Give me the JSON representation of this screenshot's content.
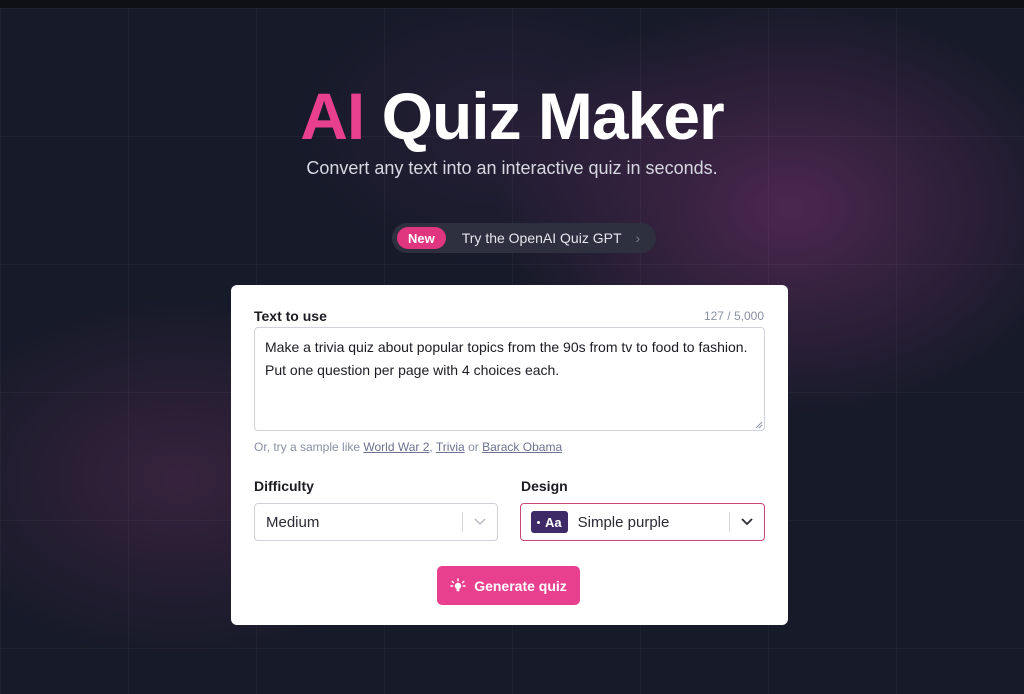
{
  "hero": {
    "title_accent": "AI",
    "title_rest": "Quiz Maker",
    "subtitle": "Convert any text into an interactive quiz in seconds."
  },
  "announcement": {
    "badge": "New",
    "text": "Try the OpenAI Quiz GPT",
    "chevron": "›"
  },
  "form": {
    "text_label": "Text to use",
    "char_count": "127 / 5,000",
    "text_value": "Make a trivia quiz about popular topics from the 90s from tv to food to fashion. Put one question per page with 4 choices each.",
    "samples_prefix": "Or, try a sample like ",
    "samples": [
      "World War 2",
      "Trivia",
      "Barack Obama"
    ],
    "samples_sep": ", ",
    "samples_or": " or ",
    "difficulty_label": "Difficulty",
    "difficulty_value": "Medium",
    "design_label": "Design",
    "design_badge": "Aa",
    "design_value": "Simple purple",
    "generate_label": "Generate quiz"
  },
  "colors": {
    "accent": "#e8408f",
    "background": "#161a29",
    "design_badge": "#3e2a66"
  },
  "icons": {
    "generate": "lightbulb-icon",
    "dropdown": "chevron-down-icon",
    "pill": "chevron-right-icon"
  }
}
